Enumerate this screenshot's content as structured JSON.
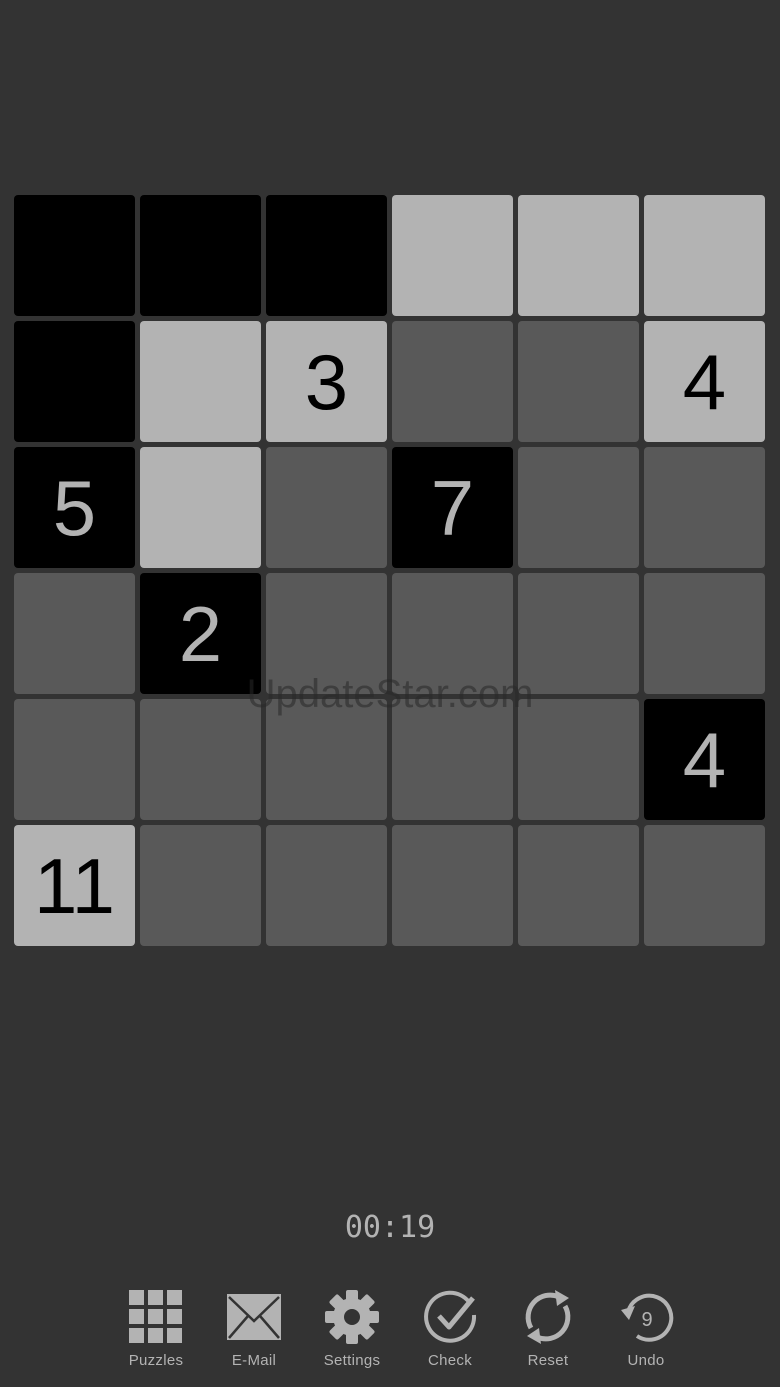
{
  "board": {
    "rows": [
      [
        {
          "state": "black",
          "clue": ""
        },
        {
          "state": "black",
          "clue": ""
        },
        {
          "state": "black",
          "clue": ""
        },
        {
          "state": "white",
          "clue": ""
        },
        {
          "state": "white",
          "clue": ""
        },
        {
          "state": "white",
          "clue": ""
        }
      ],
      [
        {
          "state": "black",
          "clue": ""
        },
        {
          "state": "white",
          "clue": ""
        },
        {
          "state": "white",
          "clue": "3"
        },
        {
          "state": "unknown",
          "clue": ""
        },
        {
          "state": "unknown",
          "clue": ""
        },
        {
          "state": "white",
          "clue": "4"
        }
      ],
      [
        {
          "state": "black",
          "clue": "5"
        },
        {
          "state": "white",
          "clue": ""
        },
        {
          "state": "unknown",
          "clue": ""
        },
        {
          "state": "black",
          "clue": "7"
        },
        {
          "state": "unknown",
          "clue": ""
        },
        {
          "state": "unknown",
          "clue": ""
        }
      ],
      [
        {
          "state": "unknown",
          "clue": ""
        },
        {
          "state": "black",
          "clue": "2"
        },
        {
          "state": "unknown",
          "clue": ""
        },
        {
          "state": "unknown",
          "clue": ""
        },
        {
          "state": "unknown",
          "clue": ""
        },
        {
          "state": "unknown",
          "clue": ""
        }
      ],
      [
        {
          "state": "unknown",
          "clue": ""
        },
        {
          "state": "unknown",
          "clue": ""
        },
        {
          "state": "unknown",
          "clue": ""
        },
        {
          "state": "unknown",
          "clue": ""
        },
        {
          "state": "unknown",
          "clue": ""
        },
        {
          "state": "black",
          "clue": "4"
        }
      ],
      [
        {
          "state": "white",
          "clue": "11"
        },
        {
          "state": "unknown",
          "clue": ""
        },
        {
          "state": "unknown",
          "clue": ""
        },
        {
          "state": "unknown",
          "clue": ""
        },
        {
          "state": "unknown",
          "clue": ""
        },
        {
          "state": "unknown",
          "clue": ""
        }
      ]
    ]
  },
  "watermark": "UpdateStar.com",
  "timer": "00:19",
  "toolbar": {
    "puzzles_label": "Puzzles",
    "email_label": "E-Mail",
    "settings_label": "Settings",
    "check_label": "Check",
    "reset_label": "Reset",
    "undo_label": "Undo",
    "undo_count": "9",
    "icons": [
      "grid-icon",
      "envelope-icon",
      "gear-icon",
      "checkmark-icon",
      "refresh-icon",
      "undo-icon"
    ]
  },
  "colors": {
    "background": "#333333",
    "black_cell": "#000000",
    "white_cell": "#b3b3b3",
    "unknown_cell": "#595959",
    "accent": "#b3b3b3"
  }
}
